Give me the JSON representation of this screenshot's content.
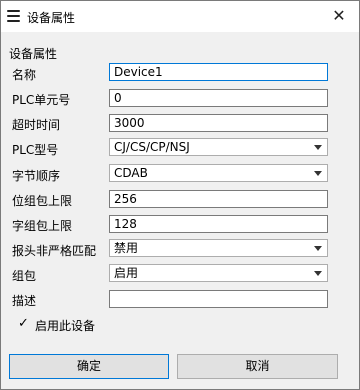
{
  "window": {
    "title": "设备属性",
    "close_glyph": "✕"
  },
  "group": {
    "label": "设备属性"
  },
  "fields": {
    "name": {
      "label": "名称",
      "value": "Device1"
    },
    "plc_unit": {
      "label": "PLC单元号",
      "value": "0"
    },
    "timeout": {
      "label": "超时时间",
      "value": "3000"
    },
    "plc_model": {
      "label": "PLC型号",
      "value": "CJ/CS/CP/NSJ"
    },
    "byte_order": {
      "label": "字节顺序",
      "value": "CDAB"
    },
    "bit_pack_limit": {
      "label": "位组包上限",
      "value": "256"
    },
    "word_pack_limit": {
      "label": "字组包上限",
      "value": "128"
    },
    "header_nonstrict": {
      "label": "报头非严格匹配",
      "value": "禁用"
    },
    "pack": {
      "label": "组包",
      "value": "启用"
    },
    "description": {
      "label": "描述",
      "value": ""
    }
  },
  "enable_device": {
    "label": "启用此设备",
    "checked": true,
    "check_glyph": "✓"
  },
  "buttons": {
    "ok": "确定",
    "cancel": "取消"
  },
  "icons": {
    "title": "list-icon",
    "combo": "chevron-down-icon"
  }
}
